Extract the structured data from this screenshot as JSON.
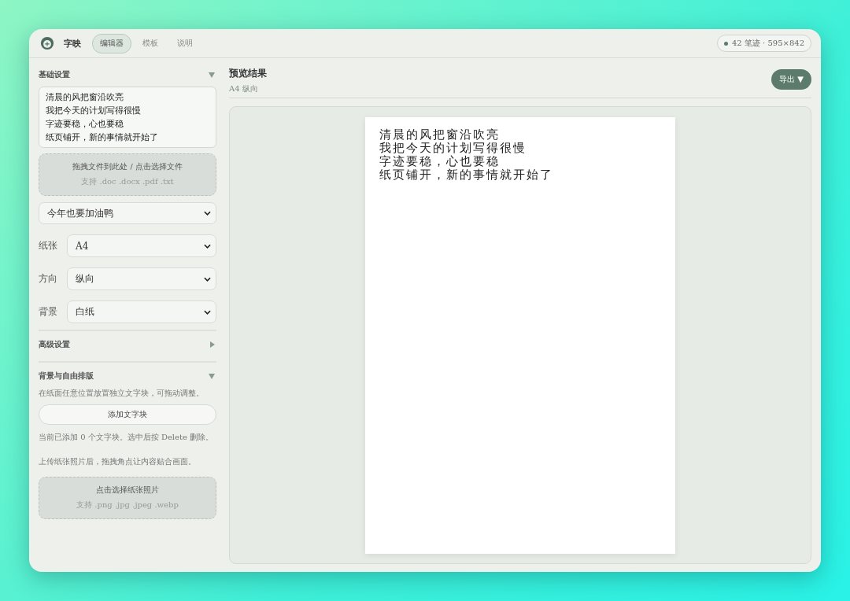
{
  "app": {
    "name": "字映"
  },
  "nav": [
    {
      "label": "编辑器",
      "selected": true
    },
    {
      "label": "模板",
      "selected": false
    },
    {
      "label": "说明",
      "selected": false
    }
  ],
  "status_chip": "42 笔迹 · 595×842",
  "basic": {
    "title": "基础设置",
    "expanded": true,
    "text_lines": [
      "清晨的风把窗沿吹亮",
      "我把今天的计划写得很慢",
      "字迹要稳，心也要稳",
      "纸页铺开，新的事情就开始了"
    ],
    "dropzone": {
      "title": "拖拽文件到此处 / 点击选择文件",
      "hint": "支持 .doc .docx .pdf .txt"
    },
    "font_select": "今年也要加油鸭",
    "fields": [
      {
        "label": "纸张",
        "value": "A4"
      },
      {
        "label": "方向",
        "value": "纵向"
      },
      {
        "label": "背景",
        "value": "白纸"
      }
    ]
  },
  "advanced": {
    "title": "高级设置",
    "expanded": false
  },
  "layout": {
    "title": "背景与自由排版",
    "expanded": true,
    "intro": "在纸面任意位置放置独立文字块，可拖动调整。",
    "add_button": "添加文字块",
    "count_note": "当前已添加 0 个文字块。选中后按 Delete 删除。",
    "photo_note": "上传纸张照片后，拖拽角点让内容贴合画面。",
    "photo_drop": {
      "title": "点击选择纸张照片",
      "hint": "支持 .png .jpg .jpeg .webp"
    }
  },
  "preview": {
    "title": "预览结果",
    "subtitle": "A4 纵向",
    "export_button": "导出 ▼",
    "lines": [
      "清晨的风把窗沿吹亮",
      "我把今天的计划写得很慢",
      "字迹要稳，心也要稳",
      "纸页铺开，新的事情就开始了"
    ]
  }
}
